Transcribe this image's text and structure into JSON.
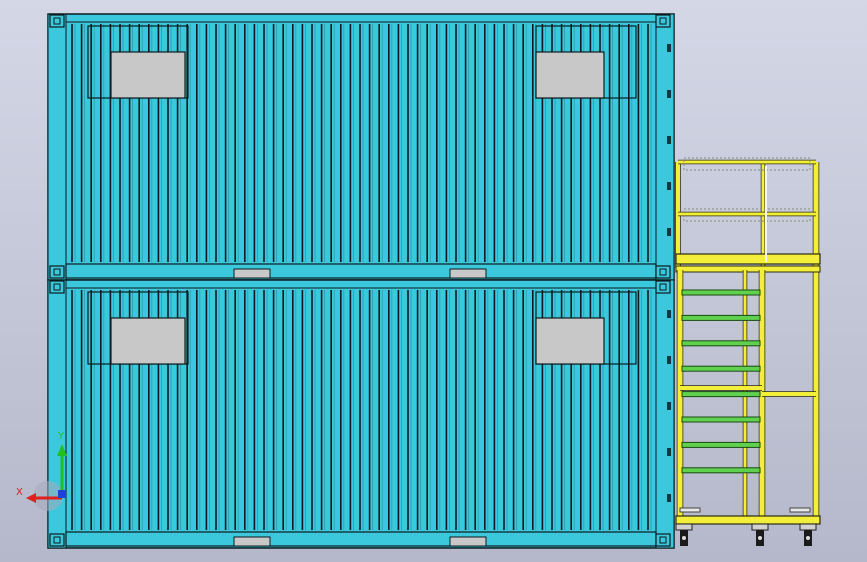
{
  "viewport": {
    "background_top": "#d4d7e6",
    "background_bottom": "#b4b8ca"
  },
  "model": {
    "container_count": 2,
    "container_color": "#3cc8dc",
    "container_edge": "#0d1a1e",
    "window_color": "#c8c8c8",
    "frame_color": "#f2ee3a",
    "step_color": "#5fd14e",
    "caster_color": "#1a1a1a"
  },
  "triad": {
    "x_label": "X",
    "y_label": "Y",
    "x_color": "#e02020",
    "y_color": "#20c020",
    "z_color": "#2040e0"
  }
}
